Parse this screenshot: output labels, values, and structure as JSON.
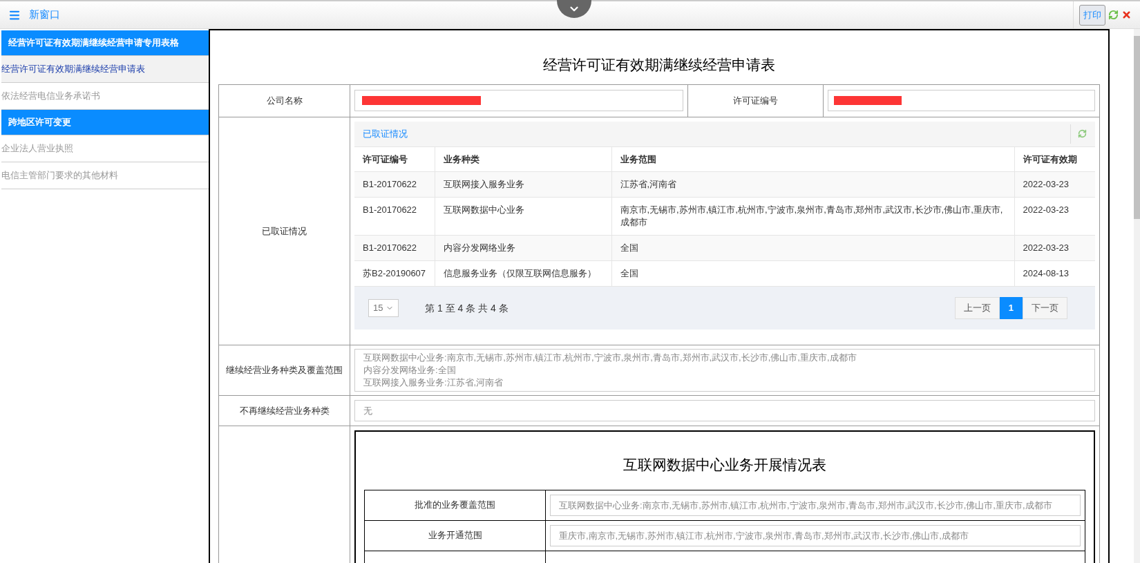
{
  "topbar": {
    "title": "新窗口",
    "print_button": "打印"
  },
  "sidebar": {
    "sections": [
      {
        "header": "经营许可证有效期满继续经营申请专用表格",
        "items": [
          {
            "label": "经营许可证有效期满继续经营申请表",
            "selected": true
          },
          {
            "label": "依法经营电信业务承诺书",
            "selected": false
          }
        ]
      },
      {
        "header": "跨地区许可变更",
        "items": [
          {
            "label": "企业法人营业执照",
            "selected": false
          },
          {
            "label": "电信主管部门要求的其他材料",
            "selected": false
          }
        ]
      }
    ]
  },
  "form": {
    "title": "经营许可证有效期满继续经营申请表",
    "company_row": {
      "company_label": "公司名称",
      "license_label": "许可证编号"
    },
    "licenses": {
      "label": "已取证情况",
      "panel_title": "已取证情况",
      "columns": [
        "许可证编号",
        "业务种类",
        "业务范围",
        "许可证有效期"
      ],
      "rows": [
        [
          "B1-20170622",
          "互联网接入服务业务",
          "江苏省,河南省",
          "2022-03-23"
        ],
        [
          "B1-20170622",
          "互联网数据中心业务",
          "南京市,无锡市,苏州市,镇江市,杭州市,宁波市,泉州市,青岛市,郑州市,武汉市,长沙市,佛山市,重庆市,成都市",
          "2022-03-23"
        ],
        [
          "B1-20170622",
          "内容分发网络业务",
          "全国",
          "2022-03-23"
        ],
        [
          "苏B2-20190607",
          "信息服务业务（仅限互联网信息服务）",
          "全国",
          "2024-08-13"
        ]
      ],
      "page_size": "15",
      "summary": "第 1 至 4 条 共 4 条",
      "pagination": [
        {
          "label": "上一页",
          "selected": false
        },
        {
          "label": "1",
          "selected": true
        },
        {
          "label": "下一页",
          "selected": false
        }
      ]
    },
    "continue_row": {
      "label": "继续经营业务种类及覆盖范围",
      "lines": [
        "互联网数据中心业务:南京市,无锡市,苏州市,镇江市,杭州市,宁波市,泉州市,青岛市,郑州市,武汉市,长沙市,佛山市,重庆市,成都市",
        "内容分发网络业务:全国",
        "互联网接入服务业务:江苏省,河南省"
      ]
    },
    "discontinue_row": {
      "label": "不再继续经营业务种类",
      "value": "无"
    },
    "idc_report": {
      "title": "互联网数据中心业务开展情况表",
      "rows": [
        {
          "label": "批准的业务覆盖范围",
          "value": "互联网数据中心业务:南京市,无锡市,苏州市,镇江市,杭州市,宁波市,泉州市,青岛市,郑州市,武汉市,长沙市,佛山市,重庆市,成都市"
        },
        {
          "label": "业务开通范围",
          "value": "重庆市,南京市,无锡市,苏州市,镇江市,杭州市,宁波市,泉州市,青岛市,郑州市,武汉市,长沙市,佛山市,成都市"
        }
      ]
    }
  }
}
